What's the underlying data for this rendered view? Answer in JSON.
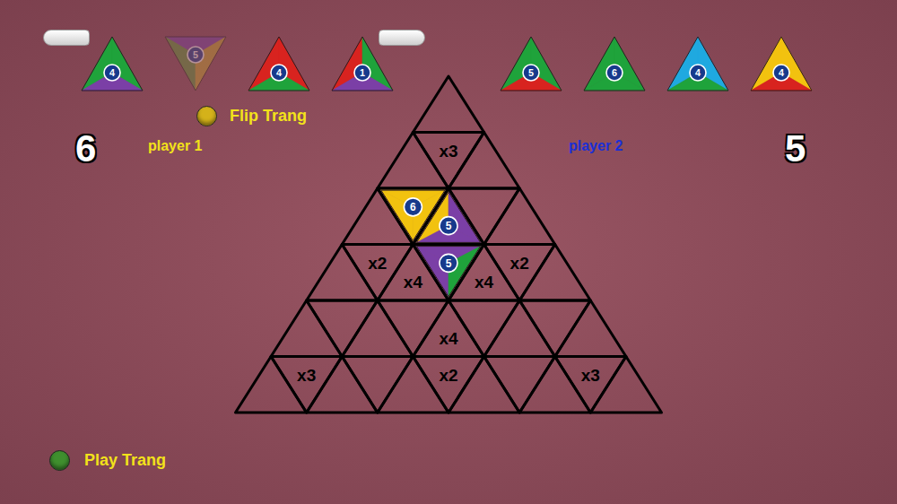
{
  "players": [
    {
      "label": "player 1",
      "score": "6",
      "color": "#f2e21a",
      "hand": [
        {
          "number": "4",
          "orientation": "up",
          "colors": [
            "#1fa33b",
            "#1fa33b",
            "#7b3fa6"
          ],
          "dimmed": false
        },
        {
          "number": "5",
          "orientation": "down",
          "colors": [
            "#7b3fa6",
            "#5f9a35",
            "#c9a52a"
          ],
          "dimmed": true
        },
        {
          "number": "4",
          "orientation": "up",
          "colors": [
            "#d8231f",
            "#d8231f",
            "#1fa33b"
          ],
          "dimmed": false
        },
        {
          "number": "1",
          "orientation": "up",
          "colors": [
            "#d8231f",
            "#1fa33b",
            "#7b3fa6"
          ],
          "dimmed": false
        }
      ]
    },
    {
      "label": "player 2",
      "score": "5",
      "color": "#1a2fd6",
      "hand": [
        {
          "number": "5",
          "orientation": "up",
          "colors": [
            "#1fa33b",
            "#1fa33b",
            "#d8231f"
          ],
          "dimmed": false
        },
        {
          "number": "6",
          "orientation": "up",
          "colors": [
            "#1fa33b",
            "#1fa33b",
            "#1fa33b"
          ],
          "dimmed": false
        },
        {
          "number": "4",
          "orientation": "up",
          "colors": [
            "#1fa9e0",
            "#1fa9e0",
            "#1fa33b"
          ],
          "dimmed": false
        },
        {
          "number": "4",
          "orientation": "up",
          "colors": [
            "#f2c20f",
            "#f2c20f",
            "#d8231f"
          ],
          "dimmed": false
        }
      ]
    }
  ],
  "actions": [
    {
      "label": "Flip Trang",
      "color": "#d4b21a"
    },
    {
      "label": "Play Trang",
      "color": "#3f8f2e"
    }
  ],
  "board": {
    "rows": [
      [
        {}
      ],
      [
        {},
        {
          "label": "x3"
        },
        {}
      ],
      [
        {},
        {
          "tile": {
            "number": "6",
            "colors": [
              "#f2c20f",
              "#f2c20f",
              "#f2c20f"
            ]
          }
        },
        {
          "tile": {
            "number": "5",
            "colors": [
              "#f2c20f",
              "#7b3fa6",
              "#7b3fa6"
            ]
          }
        },
        {},
        {}
      ],
      [
        {},
        {
          "label": "x2"
        },
        {
          "label": "x4"
        },
        {
          "tile": {
            "number": "5",
            "colors": [
              "#7b3fa6",
              "#7b3fa6",
              "#1fa33b"
            ]
          }
        },
        {
          "label": "x4"
        },
        {
          "label": "x2"
        },
        {}
      ],
      [
        {},
        {},
        {},
        {},
        {
          "label": "x4"
        },
        {},
        {},
        {},
        {}
      ],
      [
        {},
        {
          "label": "x3"
        },
        {},
        {},
        {},
        {
          "label": "x2"
        },
        {},
        {},
        {},
        {
          "label": "x3"
        },
        {}
      ]
    ]
  }
}
